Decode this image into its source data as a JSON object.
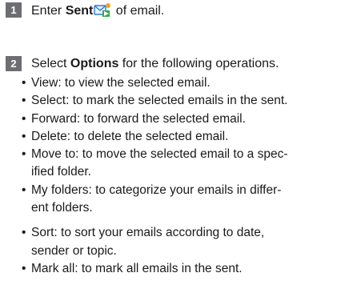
{
  "steps": [
    {
      "number": "1",
      "pre": "Enter ",
      "bold": "Sent",
      "icon": "sent-mail-icon",
      "post": " of email."
    },
    {
      "number": "2",
      "pre": "Select ",
      "bold": "Options",
      "post": " for the following operations."
    }
  ],
  "bullets": [
    {
      "lines": [
        "View: to view the selected email."
      ]
    },
    {
      "lines": [
        "Select: to mark the selected emails in the sent."
      ]
    },
    {
      "lines": [
        "Forward: to forward the selected email."
      ]
    },
    {
      "lines": [
        "Delete: to delete the selected email."
      ]
    },
    {
      "lines": [
        "Move to: to move the selected email to a spec-",
        "ified folder."
      ]
    },
    {
      "lines": [
        "My folders: to categorize your emails in differ-",
        "ent folders."
      ]
    },
    {
      "lines": [
        "Sort: to sort your emails according to date,",
        "sender or topic."
      ]
    },
    {
      "lines": [
        "Mark all: to mark all emails in the sent."
      ]
    }
  ],
  "colors": {
    "step_badge": "#6d6e71",
    "icon_blue": "#2a7fd4",
    "icon_green": "#3aa845"
  }
}
